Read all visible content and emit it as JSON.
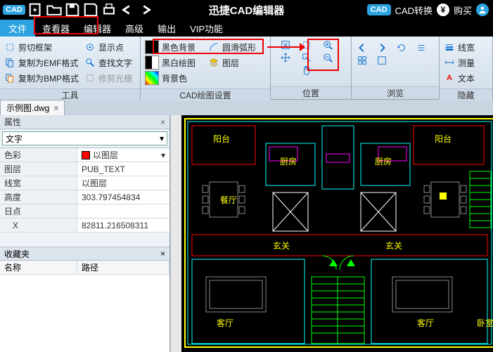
{
  "titlebar": {
    "app_badge": "CAD",
    "title": "迅捷CAD编辑器",
    "convert_badge": "CAD",
    "convert_label": "CAD转换",
    "buy_label": "购买"
  },
  "menubar": {
    "file": "文件",
    "items": [
      "查看器",
      "编辑器",
      "高级",
      "输出",
      "VIP功能"
    ]
  },
  "ribbon": {
    "groups": [
      {
        "label": "工具",
        "items": [
          {
            "icon": "crop",
            "text": "剪切框架",
            "enabled": true
          },
          {
            "icon": "point",
            "text": "显示点",
            "enabled": true
          },
          {
            "icon": "emf",
            "text": "复制为EMF格式",
            "enabled": true
          },
          {
            "icon": "find",
            "text": "查找文字",
            "enabled": true
          },
          {
            "icon": "bmp",
            "text": "复制为BMP格式",
            "enabled": true
          },
          {
            "icon": "trim",
            "text": "修剪光栅",
            "enabled": false
          }
        ]
      },
      {
        "label": "CAD绘图设置",
        "items": [
          {
            "icon": "bg-black",
            "text": "黑色背景"
          },
          {
            "icon": "arc",
            "text": "圆滑弧形"
          },
          {
            "icon": "bw",
            "text": "黑白绘图"
          },
          {
            "icon": "layers",
            "text": "图层"
          },
          {
            "icon": "bgcolor",
            "text": "背景色"
          }
        ]
      },
      {
        "label": "位置",
        "icons": [
          "fit",
          "zoom-in",
          "move",
          "zoom-out",
          "hand"
        ]
      },
      {
        "label": "浏览",
        "icons": [
          "prev",
          "next",
          "refresh",
          "list"
        ]
      },
      {
        "label": "隐藏",
        "items": [
          {
            "icon": "lw",
            "text": "线宽"
          },
          {
            "icon": "measure",
            "text": "测量"
          },
          {
            "icon": "aa",
            "text": "文本"
          }
        ]
      }
    ]
  },
  "tabs": {
    "active": "示例图.dwg"
  },
  "panel": {
    "prop_title": "属性",
    "category": "文字",
    "rows": [
      {
        "k": "色彩",
        "v": "以图层",
        "swatch": true,
        "dd": true
      },
      {
        "k": "图层",
        "v": "PUB_TEXT"
      },
      {
        "k": "线宽",
        "v": "以图层"
      },
      {
        "k": "高度",
        "v": "303.797454834"
      },
      {
        "k": "日点",
        "v": ""
      },
      {
        "k": "X",
        "v": "82811.216508311"
      }
    ],
    "fav_title": "收藏夹",
    "list_cols": [
      "名称",
      "路径"
    ]
  },
  "canvas_labels": {
    "balcony": "阳台",
    "kitchen": "厨房",
    "entry": "玄关",
    "living": "客厅",
    "bedroom": "卧室"
  }
}
